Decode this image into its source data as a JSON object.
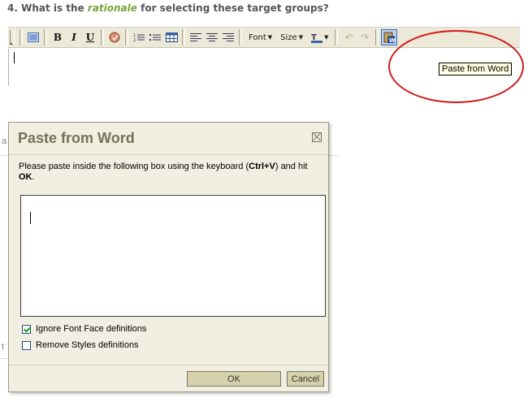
{
  "question": {
    "prefix": "4. What is the ",
    "emphasis": "rationale",
    "suffix": " for selecting these target groups?"
  },
  "toolbar": {
    "icons": [
      "view-source-icon",
      "bold-icon",
      "italic-icon",
      "underline-icon",
      "spellcheck-icon",
      "ordered-list-icon",
      "unordered-list-icon",
      "table-icon",
      "align-left-icon",
      "align-center-icon",
      "align-right-icon",
      "text-color-icon",
      "undo-icon",
      "redo-icon",
      "paste-from-word-icon"
    ],
    "bold": "B",
    "italic": "I",
    "underline": "U",
    "font_label": "Font",
    "size_label": "Size",
    "tooltip": "Paste from Word"
  },
  "dialog": {
    "title": "Paste from Word",
    "instruction_start": "Please paste inside the following box using the keyboard (",
    "instruction_key": "Ctrl+V",
    "instruction_mid": ") and hit ",
    "instruction_ok": "OK",
    "instruction_end": ".",
    "checkbox_font_label": "Ignore Font Face definitions",
    "checkbox_font_checked": true,
    "checkbox_styles_label": "Remove Styles definitions",
    "checkbox_styles_checked": false,
    "ok_label": "OK",
    "cancel_label": "Cancel"
  },
  "colors": {
    "highlight_ellipse": "#d21a1a",
    "dialog_title": "#737357",
    "emphasis": "#7ba33a"
  }
}
